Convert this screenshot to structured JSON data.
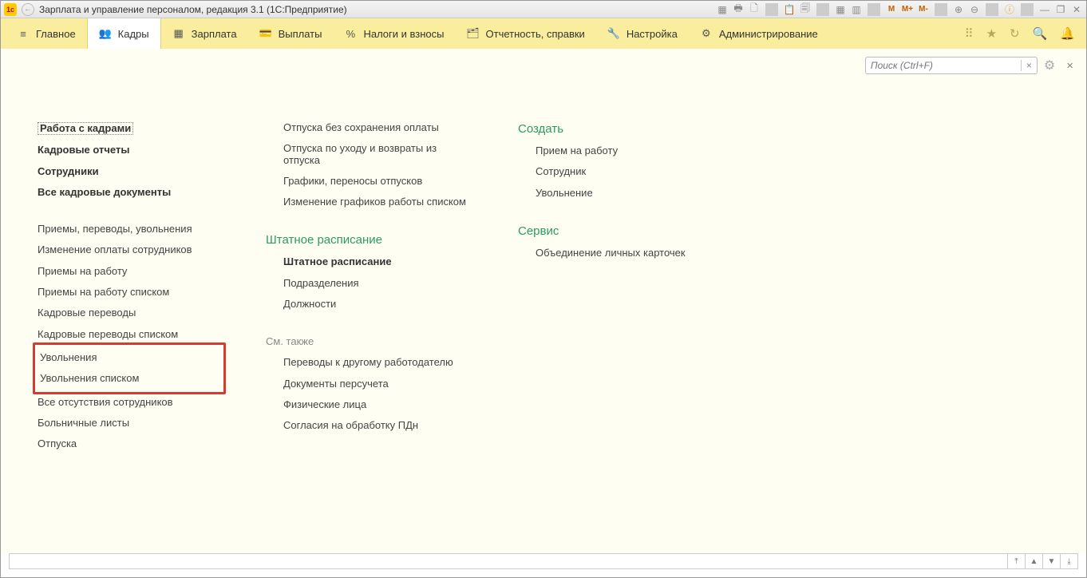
{
  "titlebar": {
    "title": "Зарплата и управление персоналом, редакция 3.1  (1С:Предприятие)"
  },
  "navbar": {
    "items": [
      {
        "label": "Главное"
      },
      {
        "label": "Кадры"
      },
      {
        "label": "Зарплата"
      },
      {
        "label": "Выплаты"
      },
      {
        "label": "Налоги и взносы"
      },
      {
        "label": "Отчетность, справки"
      },
      {
        "label": "Настройка"
      },
      {
        "label": "Администрирование"
      }
    ]
  },
  "search": {
    "placeholder": "Поиск (Ctrl+F)"
  },
  "col1": {
    "group1": [
      {
        "label": "Работа с кадрами",
        "bold": true,
        "selected": true
      },
      {
        "label": "Кадровые отчеты",
        "bold": true
      },
      {
        "label": "Сотрудники",
        "bold": true
      },
      {
        "label": "Все кадровые документы",
        "bold": true
      }
    ],
    "group2": [
      {
        "label": "Приемы, переводы, увольнения"
      },
      {
        "label": "Изменение оплаты сотрудников"
      },
      {
        "label": "Приемы на работу"
      },
      {
        "label": "Приемы на работу списком"
      },
      {
        "label": "Кадровые переводы"
      },
      {
        "label": "Кадровые переводы списком"
      },
      {
        "label": "Увольнения",
        "highlight": true
      },
      {
        "label": "Увольнения списком",
        "highlight": true
      },
      {
        "label": "Все отсутствия сотрудников"
      },
      {
        "label": "Больничные листы"
      },
      {
        "label": "Отпуска"
      }
    ]
  },
  "col2": {
    "group1": [
      {
        "label": "Отпуска без сохранения оплаты"
      },
      {
        "label": "Отпуска по уходу и возвраты из отпуска"
      },
      {
        "label": "Графики, переносы отпусков"
      },
      {
        "label": "Изменение графиков работы списком"
      }
    ],
    "section1_title": "Штатное расписание",
    "group2": [
      {
        "label": "Штатное расписание",
        "bold": true
      },
      {
        "label": "Подразделения"
      },
      {
        "label": "Должности"
      }
    ],
    "section2_title": "См. также",
    "group3": [
      {
        "label": "Переводы к другому работодателю"
      },
      {
        "label": "Документы персучета"
      },
      {
        "label": "Физические лица"
      },
      {
        "label": "Согласия на обработку ПДн"
      }
    ]
  },
  "col3": {
    "section1_title": "Создать",
    "group1": [
      {
        "label": "Прием на работу"
      },
      {
        "label": "Сотрудник"
      },
      {
        "label": "Увольнение"
      }
    ],
    "section2_title": "Сервис",
    "group2": [
      {
        "label": "Объединение личных карточек"
      }
    ]
  }
}
